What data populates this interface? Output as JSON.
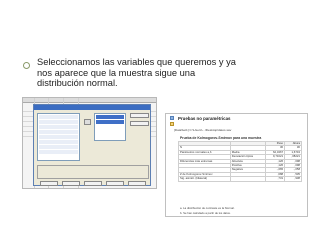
{
  "slide": {
    "caption_lines": [
      "Seleccionamos las variables que queremos y ya",
      "nos aparece que la muestra sigue una",
      "distribución normal."
    ]
  },
  "output": {
    "heading": "Pruebas no paramétricas",
    "path": "[DataSet1] C:\\Users\\...\\Desktop\\datos.sav",
    "table_title": "Prueba de Kolmogorov-Smirnov para una muestra",
    "header_cols": [
      "",
      "",
      "Peso",
      "Altura"
    ],
    "rows": [
      [
        "N",
        "",
        "30",
        "30"
      ],
      [
        "Parámetros normales a,b",
        "Media",
        "62,3467",
        "1,6743"
      ],
      [
        "",
        "Desviación típica",
        "9,71621",
        ",08221"
      ],
      [
        "Diferencias más extremas",
        "Absoluta",
        ",126",
        ",098"
      ],
      [
        "",
        "Positiva",
        ",126",
        ",098"
      ],
      [
        "",
        "Negativa",
        "-,065",
        "-,058"
      ],
      [
        "Z de Kolmogorov-Smirnov",
        "",
        ",688",
        ",535"
      ],
      [
        "Sig. asintót. (bilateral)",
        "",
        ",731",
        ",938"
      ]
    ],
    "footnotes": [
      "a. La distribución de contraste es la Normal.",
      "b. Se han calculado a partir de los datos."
    ]
  }
}
